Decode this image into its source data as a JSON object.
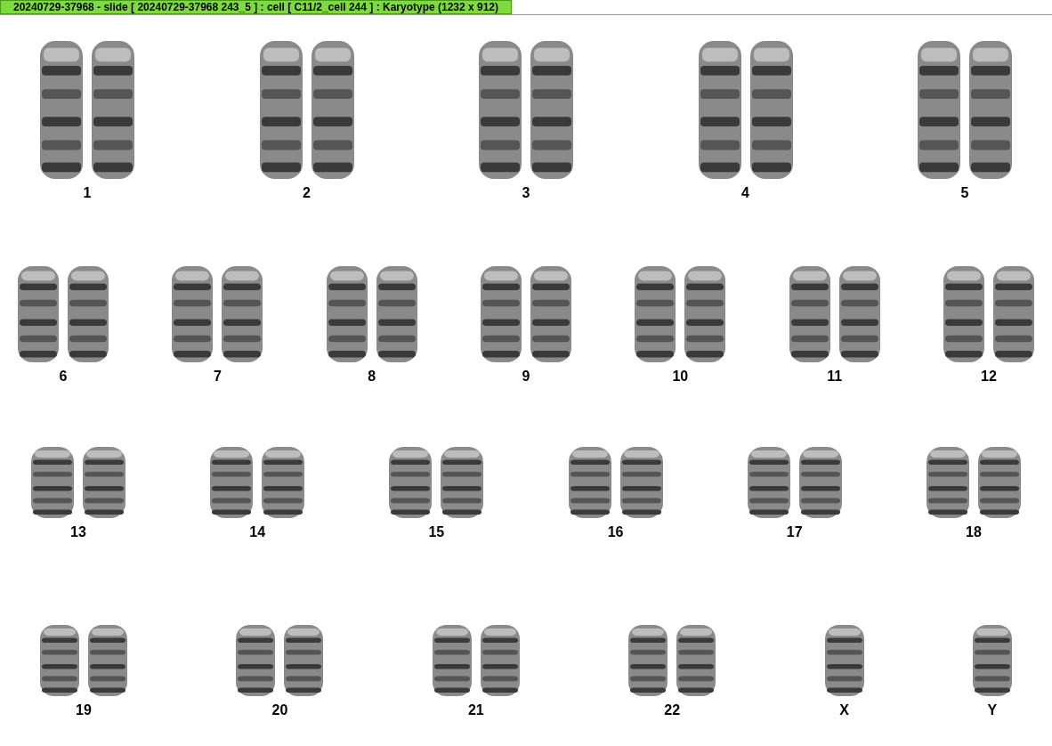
{
  "window": {
    "title": "20240729-37968 - slide [ 20240729-37968 243_5 ] : cell [ C11/2_cell 244 ] : Karyotype  (1232 x 912)"
  },
  "rows": [
    {
      "items": [
        {
          "label": "1",
          "kind": "pair"
        },
        {
          "label": "2",
          "kind": "pair"
        },
        {
          "label": "3",
          "kind": "pair"
        },
        {
          "label": "4",
          "kind": "pair"
        },
        {
          "label": "5",
          "kind": "pair"
        }
      ]
    },
    {
      "items": [
        {
          "label": "6",
          "kind": "pair"
        },
        {
          "label": "7",
          "kind": "pair"
        },
        {
          "label": "8",
          "kind": "pair"
        },
        {
          "label": "9",
          "kind": "pair"
        },
        {
          "label": "10",
          "kind": "pair"
        },
        {
          "label": "11",
          "kind": "pair"
        },
        {
          "label": "12",
          "kind": "pair"
        }
      ]
    },
    {
      "items": [
        {
          "label": "13",
          "kind": "pair"
        },
        {
          "label": "14",
          "kind": "pair"
        },
        {
          "label": "15",
          "kind": "pair"
        },
        {
          "label": "16",
          "kind": "pair"
        },
        {
          "label": "17",
          "kind": "pair"
        },
        {
          "label": "18",
          "kind": "pair"
        }
      ]
    },
    {
      "items": [
        {
          "label": "19",
          "kind": "pair"
        },
        {
          "label": "20",
          "kind": "pair"
        },
        {
          "label": "21",
          "kind": "pair"
        },
        {
          "label": "22",
          "kind": "pair"
        },
        {
          "label": "X",
          "kind": "single"
        },
        {
          "label": "Y",
          "kind": "single"
        }
      ]
    }
  ]
}
